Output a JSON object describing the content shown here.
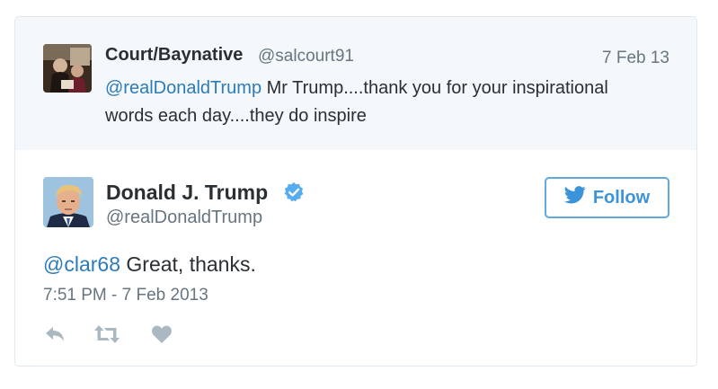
{
  "in_reply_to": {
    "display_name": "Court/Baynative",
    "handle": "@salcourt91",
    "date": "7 Feb 13",
    "mention": "@realDonaldTrump",
    "text": " Mr Trump....thank you for your inspirational words each day....they do inspire"
  },
  "tweet": {
    "display_name": "Donald J. Trump",
    "handle": "@realDonaldTrump",
    "verified": true,
    "mention": "@clar68",
    "text": " Great, thanks.",
    "timestamp": "7:51 PM - 7 Feb 2013"
  },
  "follow_button": {
    "label": "Follow",
    "icon": "twitter-bird-icon"
  },
  "actions": [
    {
      "icon": "reply-icon"
    },
    {
      "icon": "retweet-icon"
    },
    {
      "icon": "like-heart-icon"
    }
  ],
  "colors": {
    "link": "#2b7bb9",
    "follow_accent": "#3b94d9",
    "secondary_text": "#66757f",
    "context_background": "#f5f8fa",
    "verified_badge": "#55acee",
    "action_icons": "#aab8c2"
  }
}
